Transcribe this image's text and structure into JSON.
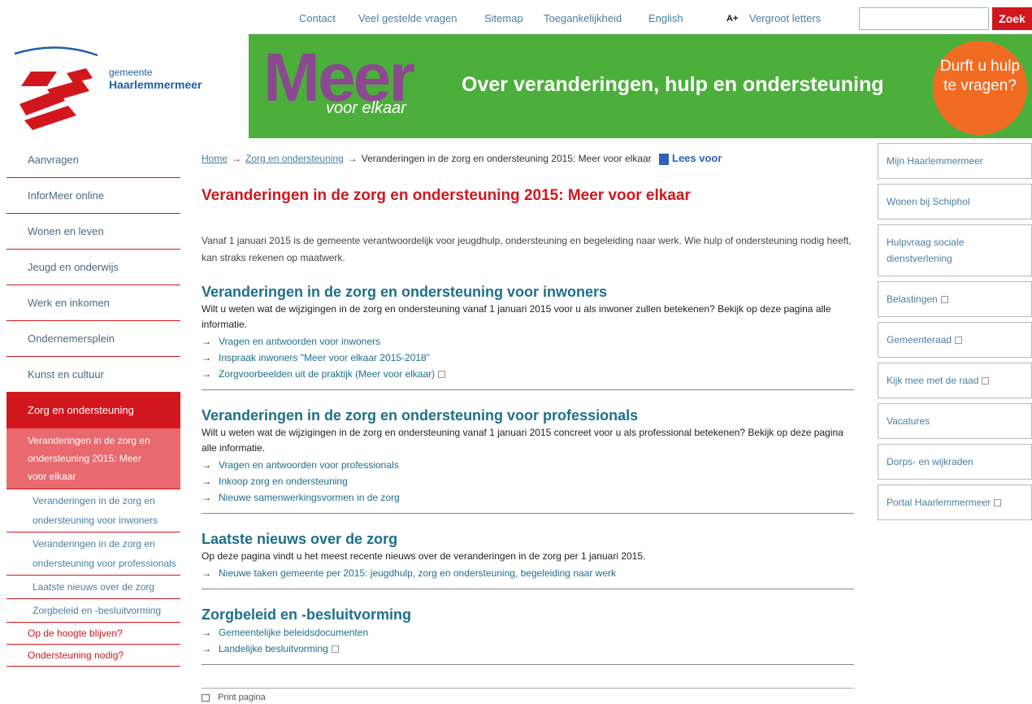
{
  "topnav": {
    "links": [
      "Contact",
      "Veel gestelde vragen",
      "Sitemap",
      "Toegankelijkheid",
      "English"
    ],
    "enlarge_icon": "A+",
    "enlarge_label": "Vergroot letters",
    "search_placeholder": "",
    "search_button": "Zoek"
  },
  "logo": {
    "line1": "gemeente",
    "line2": "Haarlemmermeer"
  },
  "banner": {
    "brand": "Meer",
    "brand_sub": "voor elkaar",
    "slogan": "Over veranderingen, hulp en ondersteuning",
    "badge": "Durft u hulp te vragen?"
  },
  "leftnav": {
    "items": [
      "Aanvragen",
      "InforMeer online",
      "Wonen en leven",
      "Jeugd en onderwijs",
      "Werk en inkomen",
      "Ondernemersplein",
      "Kunst en cultuur"
    ],
    "active": "Zorg en ondersteuning",
    "sub_highlight": "Veranderingen in de zorg en ondersteuning 2015: Meer voor elkaar",
    "sub_items": [
      "Veranderingen in de zorg en ondersteuning voor inwoners",
      "Veranderingen in de zorg en ondersteuning voor professionals",
      "Laatste nieuws over de zorg",
      "Zorgbeleid en -besluitvorming"
    ],
    "bottom_items": [
      "Op de hoogte blijven?",
      "Ondersteuning nodig?"
    ]
  },
  "breadcrumb": {
    "home": "Home",
    "level1": "Zorg en ondersteuning",
    "current": "Veranderingen in de zorg en ondersteuning 2015: Meer voor elkaar",
    "read_aloud": "Lees voor"
  },
  "main": {
    "title": "Veranderingen in de zorg en ondersteuning 2015: Meer voor elkaar",
    "intro": "Vanaf 1 januari 2015 is de gemeente verantwoordelijk voor jeugdhulp, ondersteuning en begeleiding naar werk. Wie hulp of ondersteuning nodig heeft, kan straks rekenen op maatwerk.",
    "sections": [
      {
        "heading": "Veranderingen in de zorg en ondersteuning voor inwoners",
        "text": "Wilt u weten wat de wijzigingen in de zorg en ondersteuning vanaf 1 januari 2015 voor u als inwoner zullen betekenen? Bekijk op deze pagina alle informatie.",
        "links": [
          {
            "label": "Vragen en antwoorden voor inwoners",
            "external": false
          },
          {
            "label": "Inspraak inwoners \"Meer voor elkaar 2015-2018\"",
            "external": false
          },
          {
            "label": "Zorgvoorbeelden uit de praktijk (Meer voor elkaar)",
            "external": true
          }
        ]
      },
      {
        "heading": "Veranderingen in de zorg en ondersteuning voor professionals",
        "text": "Wilt u weten wat de wijzigingen in de zorg en ondersteuning vanaf 1 januari 2015 concreet voor u als professional betekenen? Bekijk op deze pagina alle informatie.",
        "links": [
          {
            "label": "Vragen en antwoorden voor professionals",
            "external": false
          },
          {
            "label": "Inkoop zorg en ondersteuning",
            "external": false
          },
          {
            "label": "Nieuwe samenwerkingsvormen in de zorg",
            "external": false
          }
        ]
      },
      {
        "heading": "Laatste nieuws over de zorg",
        "text": "Op deze pagina vindt u het meest recente nieuws over de veranderingen in de zorg per 1 januari 2015.",
        "links": [
          {
            "label": "Nieuwe taken gemeente per 2015: jeugdhulp, zorg en ondersteuning, begeleiding naar werk",
            "external": false
          }
        ]
      },
      {
        "heading": "Zorgbeleid en -besluitvorming",
        "text": "",
        "links": [
          {
            "label": "Gemeentelijke beleidsdocumenten",
            "external": false
          },
          {
            "label": "Landelijke besluitvorming",
            "external": true
          }
        ]
      }
    ],
    "print": "Print pagina"
  },
  "rightnav": {
    "items": [
      {
        "label": "Mijn Haarlemmermeer",
        "external": false
      },
      {
        "label": "Wonen bij Schiphol",
        "external": false
      },
      {
        "label": "Hulpvraag sociale dienstverlening",
        "external": false
      },
      {
        "label": "Belastingen",
        "external": true
      },
      {
        "label": "Gemeenteraad",
        "external": true
      },
      {
        "label": "Kijk mee met de raad",
        "external": true
      },
      {
        "label": "Vacatures",
        "external": false
      },
      {
        "label": "Dorps- en wijkraden",
        "external": false
      },
      {
        "label": "Portal Haarlemmermeer",
        "external": true
      }
    ]
  },
  "colors": {
    "accent_red": "#d2161e",
    "banner_green": "#4caf3b",
    "badge_orange": "#f26b22",
    "heading_teal": "#1e6f8c"
  }
}
